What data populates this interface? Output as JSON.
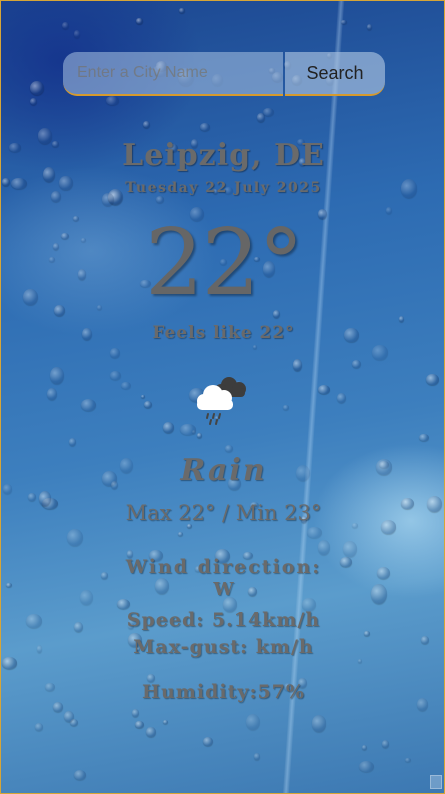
{
  "search": {
    "placeholder": "Enter a City Name",
    "button_label": "Search"
  },
  "location": {
    "city": "Leipzig, DE",
    "date": "Tuesday 22 July 2025"
  },
  "weather": {
    "temperature": "22°",
    "feels_like": "Feels like 22°",
    "condition": "Rain",
    "condition_icon": "rain-cloud-icon",
    "min_max": "Max 22° / Min 23°",
    "wind_label": "Wind direction:",
    "wind_direction": "W",
    "speed": "Speed: 5.14km/h",
    "max_gust": "Max-gust: km/h",
    "humidity": "Humidity:57%"
  },
  "colors": {
    "accent_border": "#d59a2e",
    "text": "#6a6a6a"
  }
}
